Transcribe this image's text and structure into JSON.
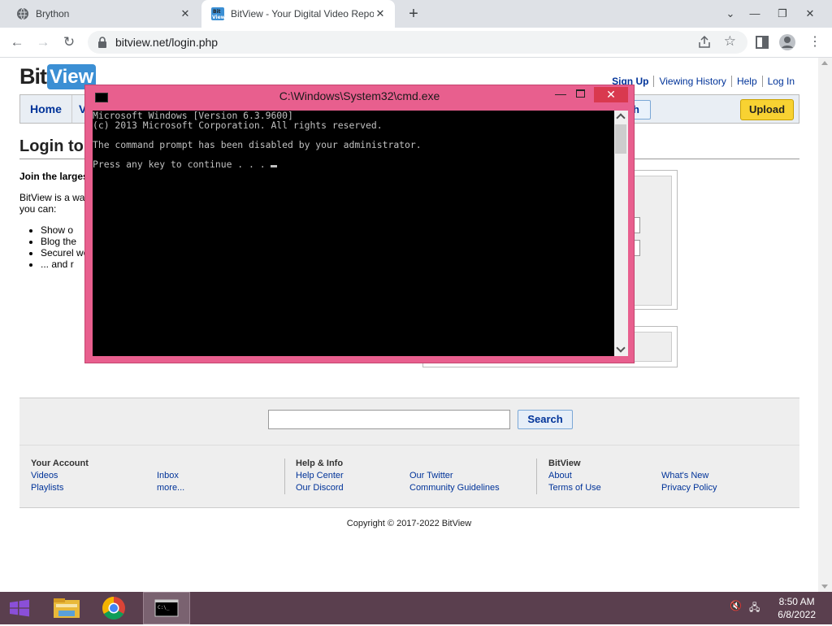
{
  "browser": {
    "tabs": [
      {
        "title": "Brython",
        "active": false
      },
      {
        "title": "BitView - Your Digital Video Repo",
        "active": true
      }
    ],
    "url": "bitview.net/login.php",
    "newtab_label": "+"
  },
  "site": {
    "logo": {
      "bit": "Bit",
      "view": "View"
    },
    "top_links": [
      "Sign Up",
      "Viewing History",
      "Help",
      "Log In"
    ],
    "nav": {
      "home": "Home",
      "partial": "V",
      "search_partial": "h",
      "upload": "Upload"
    },
    "heading_partial": "Login to",
    "join_partial": "Join the larges",
    "intro_partial": "BitView is a wa you can:",
    "bullets_partial": [
      "Show o",
      "Blog the",
      "Securel world",
      "... and r"
    ],
    "footer": {
      "search_button": "Search",
      "columns": [
        {
          "head": "Your Account",
          "links": [
            "Videos",
            "Playlists"
          ]
        },
        {
          "head": "",
          "links": [
            "Inbox",
            "more..."
          ]
        },
        {
          "head": "Help & Info",
          "links": [
            "Help Center",
            "Our Discord"
          ]
        },
        {
          "head": "",
          "links": [
            "Our Twitter",
            "Community Guidelines"
          ]
        },
        {
          "head": "BitView",
          "links": [
            "About",
            "Terms of Use"
          ]
        },
        {
          "head": "",
          "links": [
            "What's New",
            "Privacy Policy"
          ]
        }
      ],
      "copyright": "Copyright © 2017-2022 BitView"
    }
  },
  "cmd": {
    "title": "C:\\Windows\\System32\\cmd.exe",
    "lines": [
      "Microsoft Windows [Version 6.3.9600]",
      "(c) 2013 Microsoft Corporation. All rights reserved.",
      "",
      "The command prompt has been disabled by your administrator.",
      "",
      "Press any key to continue . . . "
    ]
  },
  "taskbar": {
    "time": "8:50 AM",
    "date": "6/8/2022"
  }
}
